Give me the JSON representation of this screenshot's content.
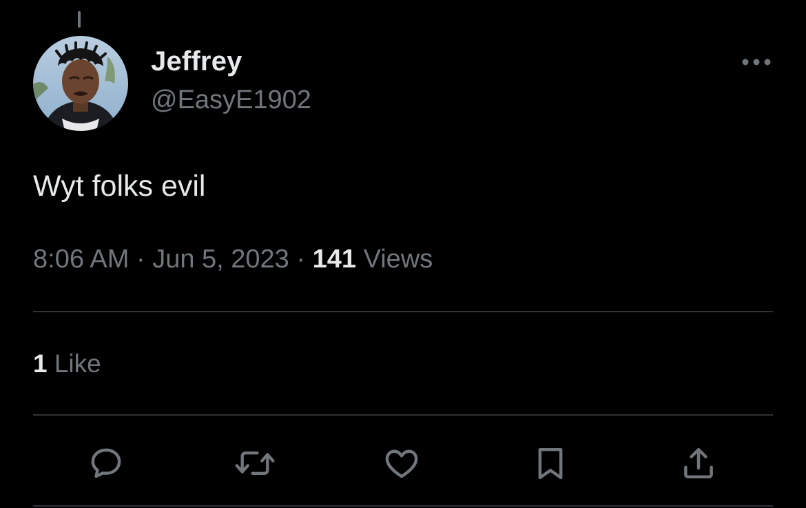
{
  "author": {
    "display_name": "Jeffrey",
    "handle": "@EasyE1902",
    "avatar_icon": "profile-photo"
  },
  "tweet": {
    "text": "Wyt folks evil",
    "time": "8:06 AM",
    "separator": "·",
    "date": "Jun 5, 2023",
    "views_count": "141",
    "views_label": "Views"
  },
  "engagement": {
    "likes_count": "1",
    "likes_label": "Like"
  },
  "actions": [
    {
      "icon": "reply-icon"
    },
    {
      "icon": "retweet-icon"
    },
    {
      "icon": "like-icon"
    },
    {
      "icon": "bookmark-icon"
    },
    {
      "icon": "share-icon"
    }
  ],
  "colors": {
    "background": "#000000",
    "primary_text": "#e7e9ea",
    "secondary_text": "#71767b",
    "divider": "#2f3336"
  }
}
